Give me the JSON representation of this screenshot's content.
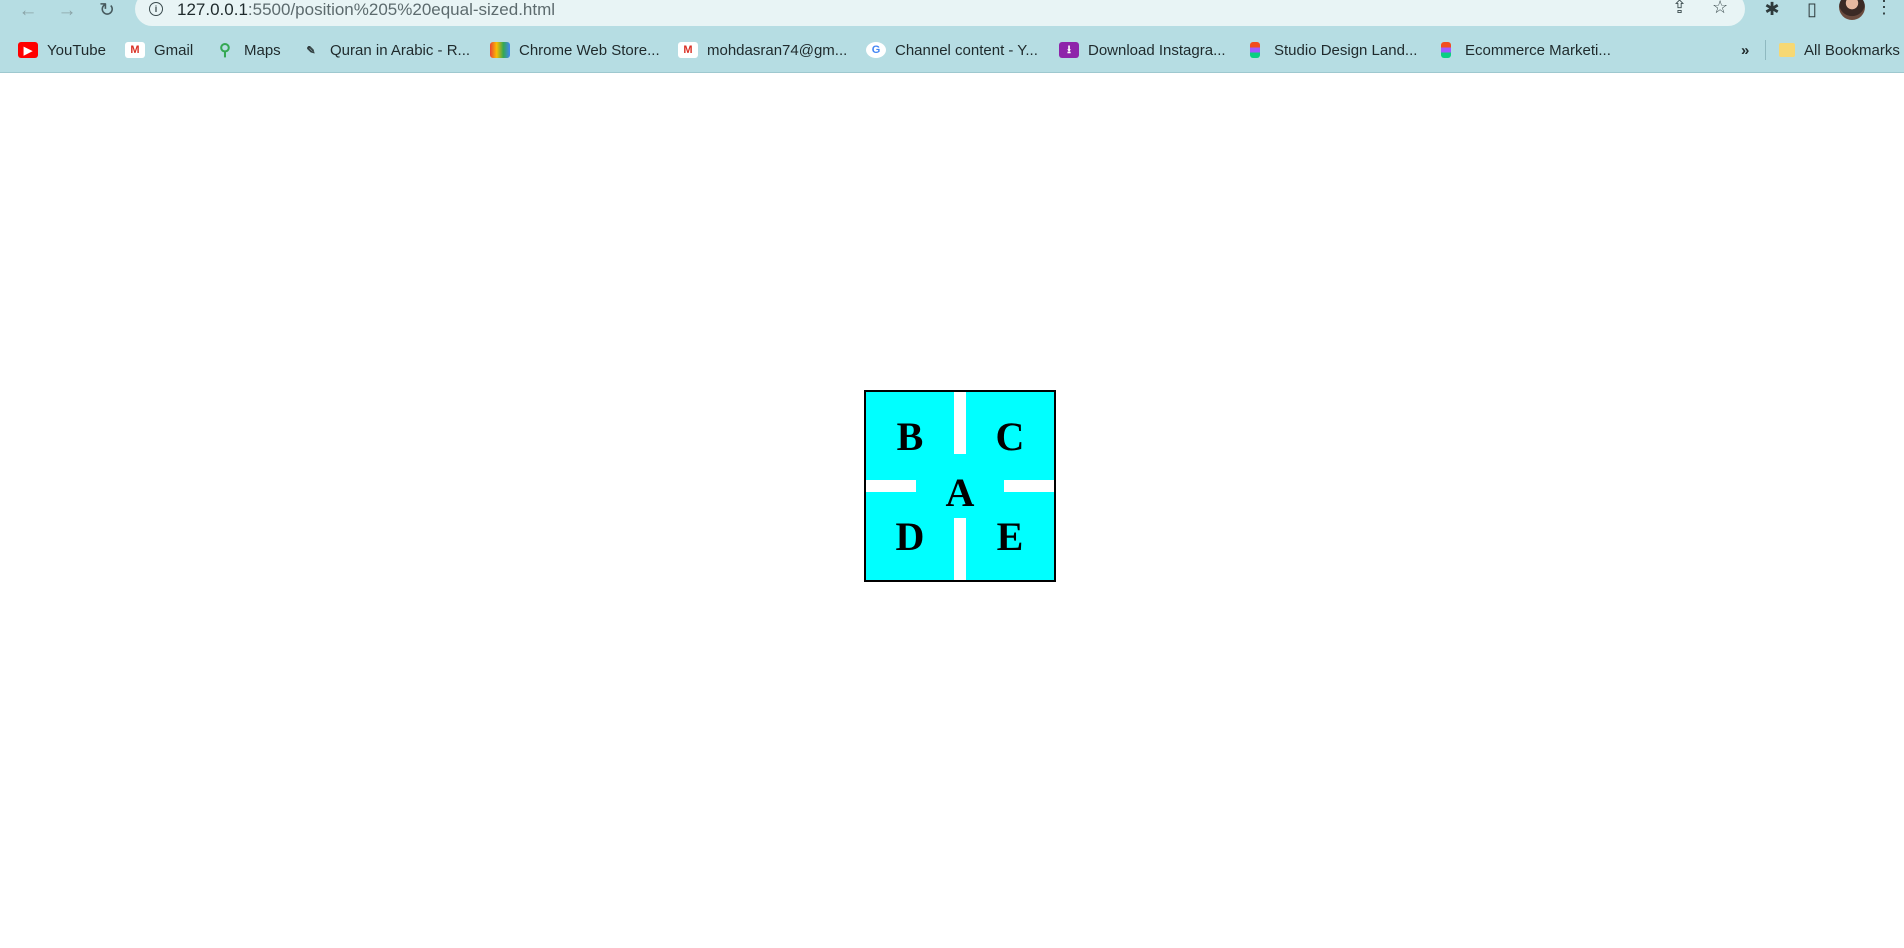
{
  "browser": {
    "url_host": "127.0.0.1",
    "url_rest": ":5500/position%205%20equal-sized.html",
    "bookmarks": [
      {
        "label": "YouTube",
        "icon": "youtube-icon"
      },
      {
        "label": "Gmail",
        "icon": "gmail-icon"
      },
      {
        "label": "Maps",
        "icon": "maps-icon"
      },
      {
        "label": "Quran in Arabic - R...",
        "icon": "quran-icon"
      },
      {
        "label": "Chrome Web Store...",
        "icon": "chrome-web-store-icon"
      },
      {
        "label": "mohdasran74@gm...",
        "icon": "gmail-icon"
      },
      {
        "label": "Channel content - Y...",
        "icon": "google-icon"
      },
      {
        "label": "Download Instagra...",
        "icon": "download-icon"
      },
      {
        "label": "Studio Design Land...",
        "icon": "figma-icon"
      },
      {
        "label": "Ecommerce Marketi...",
        "icon": "figma-icon"
      }
    ],
    "overflow_label": "»",
    "all_bookmarks_label": "All Bookmarks"
  },
  "page": {
    "boxes": {
      "a": "A",
      "b": "B",
      "c": "C",
      "d": "D",
      "e": "E"
    },
    "colors": {
      "box_fill": "#00ffff",
      "border": "#000000",
      "background": "#ffffff"
    }
  }
}
